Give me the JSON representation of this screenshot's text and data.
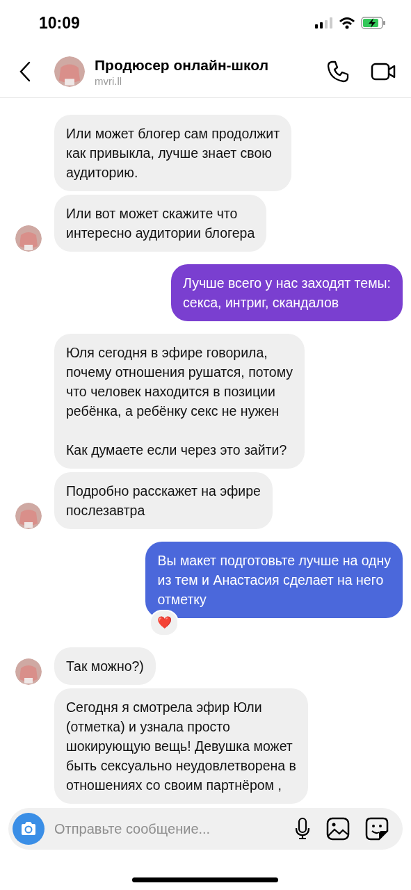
{
  "status_bar": {
    "time": "10:09"
  },
  "header": {
    "title": "Продюсер онлайн-школ",
    "username": "mvri.ll"
  },
  "messages": [
    {
      "kind": "incoming",
      "text": "Или может блогер сам продолжит\nкак привыкла, лучше знает свою\nаудиторию.",
      "avatar": false
    },
    {
      "kind": "incoming",
      "text": "Или вот может скажите что\nинтересно аудитории блогера",
      "avatar": true
    },
    {
      "kind": "outgoing",
      "text": "Лучше всего у нас заходят темы:\nсекса, интриг, скандалов",
      "color": "#7a3fd0"
    },
    {
      "kind": "incoming",
      "text": "Юля сегодня в эфире говорила,\nпочему отношения рушатся, потому\nчто человек находится в позиции\nребёнка, а ребёнку секс не нужен\n\nКак думаете если через это зайти?",
      "avatar": false
    },
    {
      "kind": "incoming",
      "text": "Подробно расскажет на эфире\nпослезавтра",
      "avatar": true
    },
    {
      "kind": "outgoing",
      "text": "Вы макет подготовьте лучше на одну\nиз тем и Анастасия сделает на него\nотметку",
      "color": "#4b68db",
      "reaction": "❤️"
    },
    {
      "kind": "incoming",
      "text": "Так можно?)",
      "avatar": true
    },
    {
      "kind": "incoming",
      "text": "Сегодня я смотрела эфир Юли\n(отметка) и узнала просто\nшокирующую вещь! Девушка может\nбыть сексуально неудовлетворена в\nотношениях со своим партнёром ,",
      "avatar": false
    }
  ],
  "composer": {
    "placeholder": "Отправьте сообщение..."
  }
}
